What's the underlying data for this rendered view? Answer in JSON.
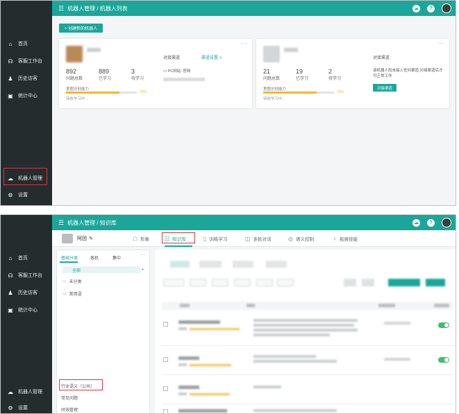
{
  "panel1": {
    "sidebar": {
      "items": [
        {
          "icon": "home-icon",
          "label": "首页"
        },
        {
          "icon": "headset-icon",
          "label": "客服工作台"
        },
        {
          "icon": "history-icon",
          "label": "历史访客"
        },
        {
          "icon": "chart-icon",
          "label": "统计中心"
        }
      ],
      "bottom": [
        {
          "icon": "robot-cloud-icon",
          "label": "机器人管理"
        },
        {
          "icon": "gear-icon",
          "label": "设置"
        }
      ]
    },
    "header": {
      "title": "机器人管理 / 机器人列表"
    },
    "create_button": "+ 创建新的机器人",
    "cards": [
      {
        "stats": [
          {
            "value": "892",
            "label": "问题总数"
          },
          {
            "value": "889",
            "label": "已学习"
          },
          {
            "value": "3",
            "label": "待学习"
          }
        ],
        "ability_label": "意图识别能力",
        "ability_pct": 75,
        "ability_pct_text": "75%",
        "waiting_text": "待依学习中...",
        "channel_heading": "对接渠道",
        "channel_link": "渠道设置 >",
        "channel_line": "PC网站: 官网"
      },
      {
        "stats": [
          {
            "value": "21",
            "label": "问题总数"
          },
          {
            "value": "19",
            "label": "已学习"
          },
          {
            "value": "2",
            "label": "待学习"
          }
        ],
        "ability_label": "意图识别能力",
        "ability_pct": 75,
        "ability_pct_text": "75%",
        "waiting_text": "待依学习中...",
        "channel_heading": "对接渠道",
        "no_channel_text": "该机器人尚未接入任何渠道,对接渠道后才可正常工作",
        "channel_button": "对接渠道"
      }
    ]
  },
  "panel2": {
    "sidebar": {
      "items": [
        {
          "icon": "home-icon",
          "label": "首页"
        },
        {
          "icon": "headset-icon",
          "label": "客服工作台"
        },
        {
          "icon": "history-icon",
          "label": "历史访客"
        },
        {
          "icon": "chart-icon",
          "label": "统计中心"
        }
      ],
      "bottom": [
        {
          "icon": "robot-cloud-icon",
          "label": "机器人管理"
        },
        {
          "icon": "gear-icon",
          "label": "设置"
        }
      ]
    },
    "header": {
      "title": "机器人管理 / 知识库"
    },
    "robot_name": "阿团",
    "tabs": [
      {
        "icon": "chat-icon",
        "label": "形象"
      },
      {
        "icon": "knowledge-icon",
        "label": "知识库",
        "active": true
      },
      {
        "icon": "book-icon",
        "label": "训练学习"
      },
      {
        "icon": "dialog-icon",
        "label": "多轮对话"
      },
      {
        "icon": "semantic-icon",
        "label": "语义控制"
      },
      {
        "icon": "bulb-icon",
        "label": "拓展技能"
      }
    ],
    "category_tabs": [
      "基础分类",
      "客机",
      "集中"
    ],
    "category_all": "全部",
    "categories": [
      "未分类",
      "常用语"
    ],
    "bottom_categories": [
      "行业语义（公共）",
      "常见问题",
      "时效管理"
    ]
  },
  "colors": {
    "brand": "#1aa79a",
    "sidebar": "#252c2e",
    "highlight": "#d9363e",
    "progress": "#f5b633",
    "toggle_on": "#3cc06a"
  }
}
